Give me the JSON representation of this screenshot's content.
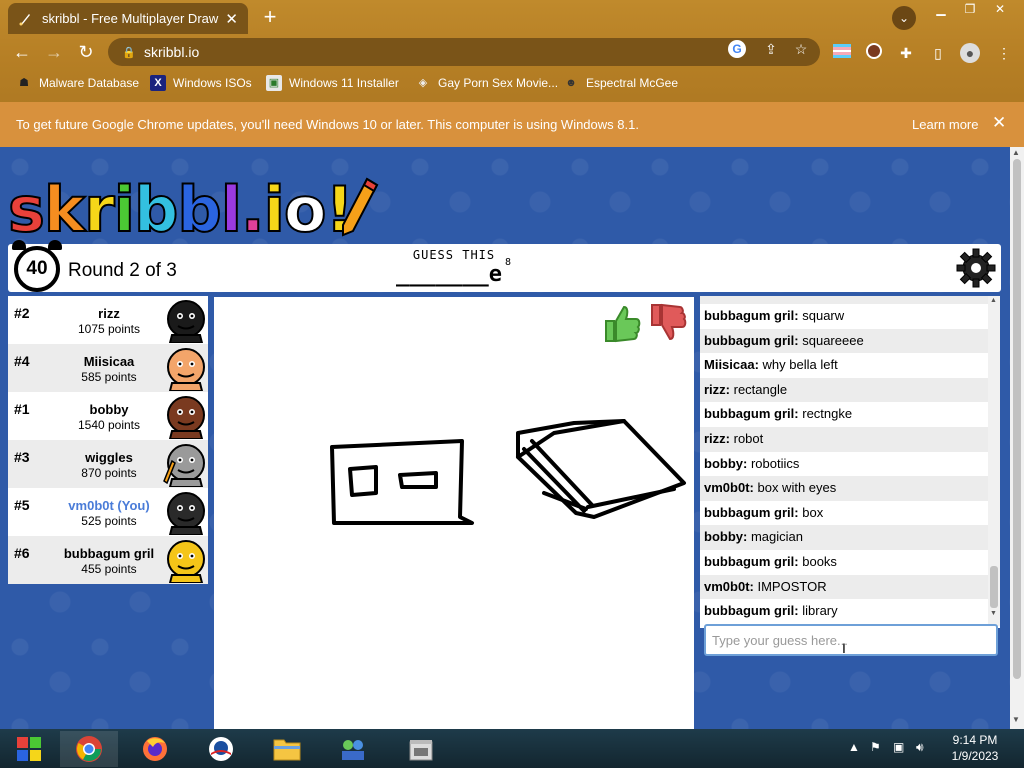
{
  "browser": {
    "tab_title": "skribbl - Free Multiplayer Drawing",
    "url": "skribbl.io",
    "bookmarks": [
      {
        "label": "Malware Database"
      },
      {
        "label": "Windows ISOs"
      },
      {
        "label": "Windows 11 Installer"
      },
      {
        "label": "Gay Porn Sex Movie..."
      },
      {
        "label": "Espectral McGee"
      }
    ],
    "infobar": {
      "message": "To get future Google Chrome updates, you'll need Windows 10 or later. This computer is using Windows 8.1.",
      "learn_more": "Learn more"
    }
  },
  "game": {
    "logo_text": "skribbl.io!",
    "timer": "40",
    "round": "Round 2 of 3",
    "guess_title": "GUESS THIS",
    "word_hint": "_______e",
    "word_length": "8",
    "players": [
      {
        "rank": "#2",
        "name": "rizz",
        "points": "1075 points",
        "avatar_color": "#1a1a1a",
        "is_you": false
      },
      {
        "rank": "#4",
        "name": "Miisicaa",
        "points": "585 points",
        "avatar_color": "#f3a56a",
        "is_you": false
      },
      {
        "rank": "#1",
        "name": "bobby",
        "points": "1540 points",
        "avatar_color": "#7a3a20",
        "is_you": false
      },
      {
        "rank": "#3",
        "name": "wiggles",
        "points": "870 points",
        "avatar_color": "#9a9a9a",
        "is_you": false,
        "drawing": true
      },
      {
        "rank": "#5",
        "name": "vm0b0t (You)",
        "points": "525 points",
        "avatar_color": "#2a2a2a",
        "is_you": true
      },
      {
        "rank": "#6",
        "name": "bubbagum gril",
        "points": "455 points",
        "avatar_color": "#f5c518",
        "is_you": false
      }
    ],
    "chat": [
      {
        "user": "bubbagum gril:",
        "text": "squarw"
      },
      {
        "user": "bubbagum gril:",
        "text": "squareeee"
      },
      {
        "user": "Miisicaa:",
        "text": "why bella left"
      },
      {
        "user": "rizz:",
        "text": "rectangle"
      },
      {
        "user": "bubbagum gril:",
        "text": "rectngke"
      },
      {
        "user": "rizz:",
        "text": "robot"
      },
      {
        "user": "bobby:",
        "text": "robotiics"
      },
      {
        "user": "vm0b0t:",
        "text": "box with eyes"
      },
      {
        "user": "bubbagum gril:",
        "text": "box"
      },
      {
        "user": "bobby:",
        "text": "magician"
      },
      {
        "user": "bubbagum gril:",
        "text": "books"
      },
      {
        "user": "vm0b0t:",
        "text": "IMPOSTOR"
      },
      {
        "user": "bubbagum gril:",
        "text": "library"
      }
    ],
    "chat_placeholder": "Type your guess here..."
  },
  "taskbar": {
    "time": "9:14 PM",
    "date": "1/9/2023"
  }
}
